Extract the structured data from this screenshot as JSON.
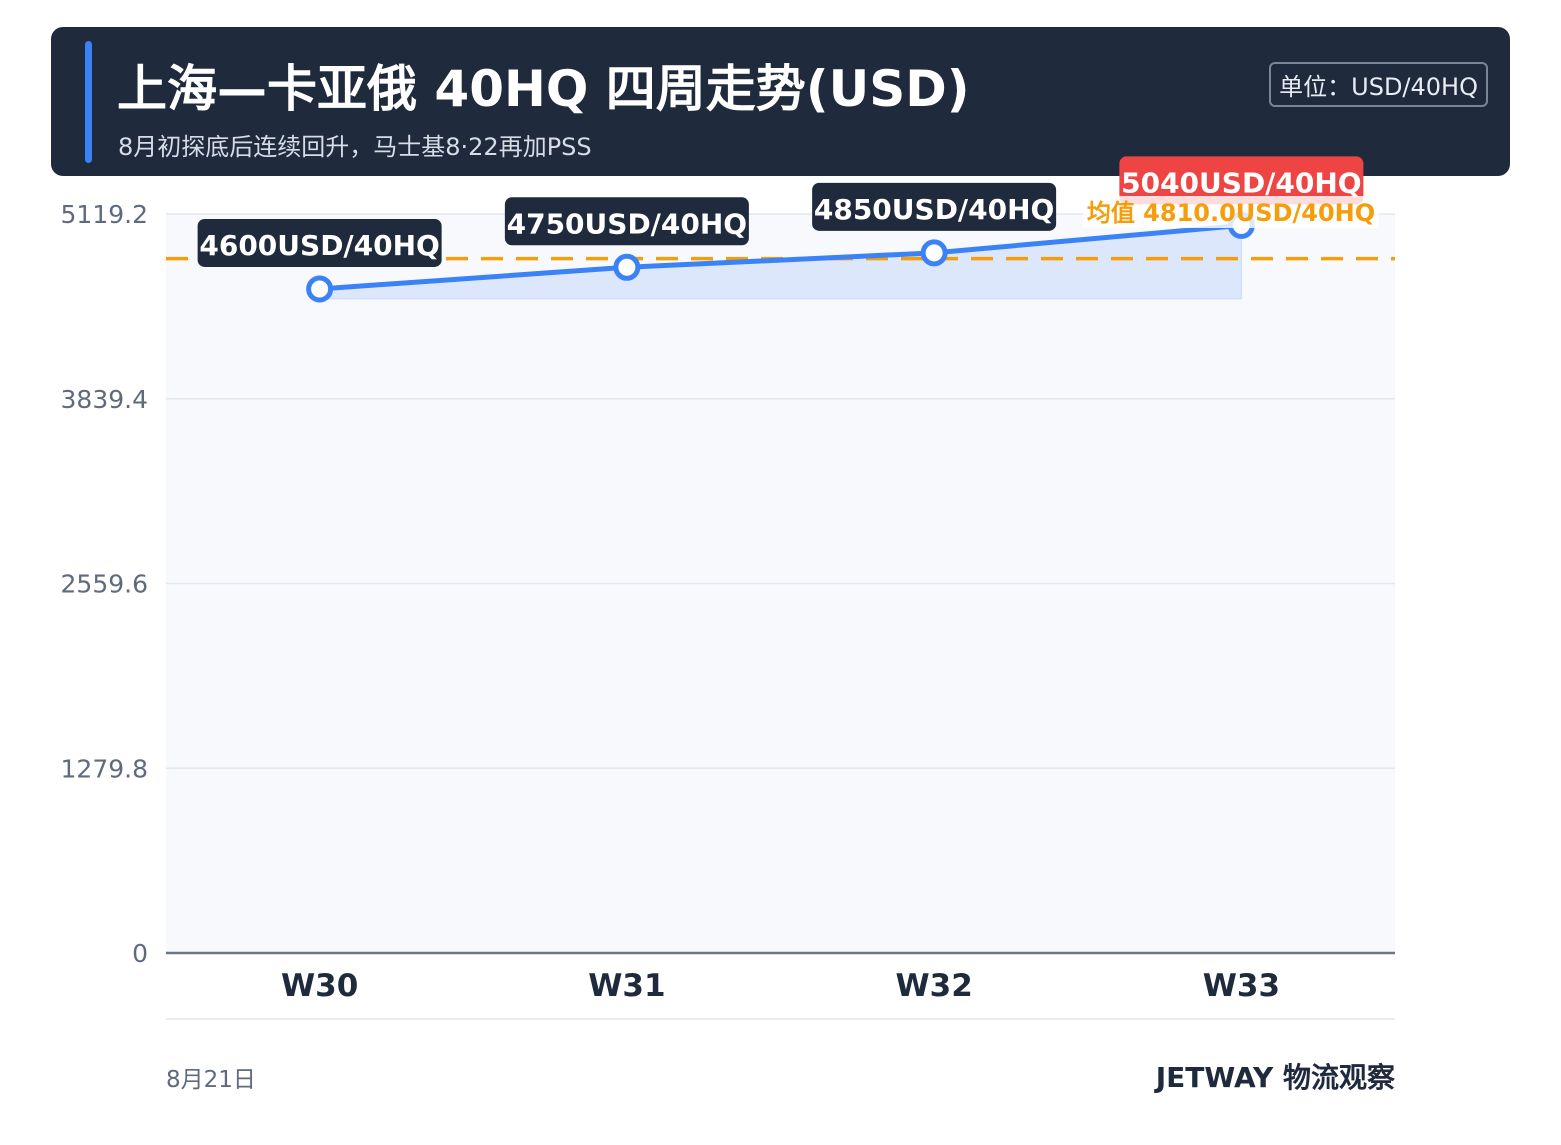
{
  "header": {
    "title": "上海—卡亚俄 40HQ 四周走势(USD)",
    "subtitle": "8月初探底后连续回升，马士基8·22再加PSS",
    "unit_badge": "单位：USD/40HQ"
  },
  "chart_data": {
    "type": "line",
    "title": "上海—卡亚俄 40HQ 四周走势(USD)",
    "subtitle": "8月初探底后连续回升，马士基8·22再加PSS",
    "categories": [
      "W30",
      "W31",
      "W32",
      "W33"
    ],
    "series": [
      {
        "values": [
          4600,
          4750,
          4850,
          5040
        ]
      }
    ],
    "data_labels": [
      "4600USD/40HQ",
      "4750USD/40HQ",
      "4850USD/40HQ",
      "5040USD/40HQ"
    ],
    "y_ticks": [
      "0",
      "1279.8",
      "2559.6",
      "3839.4",
      "5119.2"
    ],
    "ylim": [
      0,
      5119.2
    ],
    "average": {
      "value": 4810,
      "label": "均值 4810.0USD/40HQ"
    },
    "grid": true,
    "colors": {
      "line": "#3b82f6",
      "average": "#f59e0b",
      "highlight": "#ef4444",
      "label_bg": "#1f2a3d"
    }
  },
  "footer": {
    "date": "8月21日",
    "brand": "JETWAY 物流观察"
  }
}
